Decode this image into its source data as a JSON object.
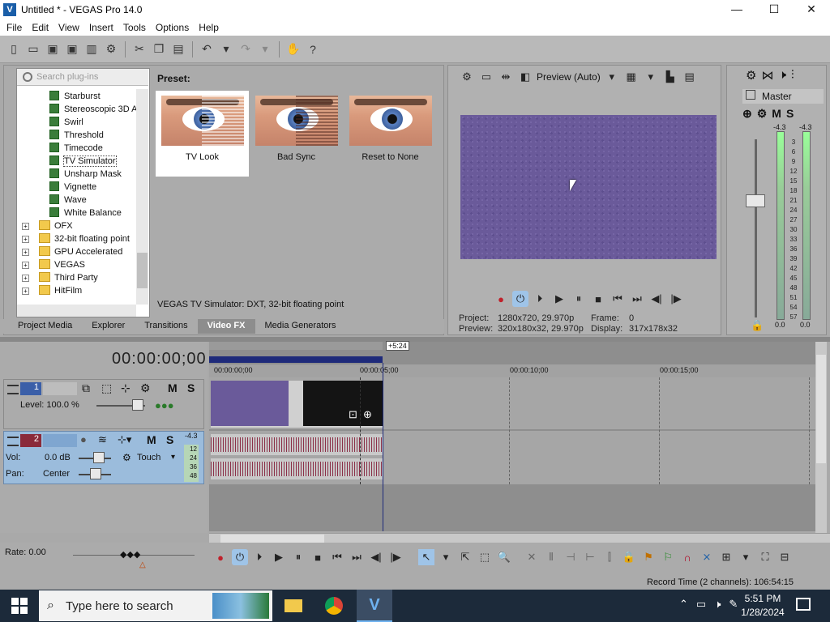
{
  "window": {
    "title": "Untitled * - VEGAS Pro 14.0",
    "logo": "V",
    "minimize": "—",
    "maximize": "☐",
    "close": "✕"
  },
  "menu": [
    "File",
    "Edit",
    "View",
    "Insert",
    "Tools",
    "Options",
    "Help"
  ],
  "plugins": {
    "search_placeholder": "Search plug-ins",
    "items": [
      "Starburst",
      "Stereoscopic 3D A",
      "Swirl",
      "Threshold",
      "Timecode",
      "TV Simulator",
      "Unsharp Mask",
      "Vignette",
      "Wave",
      "White Balance"
    ],
    "folders": [
      "OFX",
      "32-bit floating point",
      "GPU Accelerated",
      "VEGAS",
      "Third Party",
      "HitFilm"
    ],
    "selected": "TV Simulator"
  },
  "preset": {
    "label": "Preset:",
    "items": [
      "TV Look",
      "Bad Sync",
      "Reset to None"
    ],
    "status": "VEGAS TV Simulator: DXT, 32-bit floating point"
  },
  "tabs": [
    "Project Media",
    "Explorer",
    "Transitions",
    "Video FX",
    "Media Generators"
  ],
  "active_tab": "Video FX",
  "preview": {
    "mode": "Preview (Auto)",
    "project_label": "Project:",
    "project_value": "1280x720, 29.970p",
    "preview_label": "Preview:",
    "preview_value": "320x180x32, 29.970p",
    "frame_label": "Frame:",
    "frame_value": "0",
    "display_label": "Display:",
    "display_value": "317x178x32"
  },
  "mixer": {
    "label": "Master",
    "m": "M",
    "s": "S",
    "peak_left": "-4.3",
    "peak_right": "-4.3",
    "scale": [
      "3",
      "6",
      "9",
      "12",
      "15",
      "18",
      "21",
      "24",
      "27",
      "30",
      "33",
      "36",
      "39",
      "42",
      "45",
      "48",
      "51",
      "54",
      "57"
    ],
    "level_left": "0.0",
    "level_right": "0.0"
  },
  "timeline": {
    "timecode": "00:00:00;00",
    "loop_label": "+5:24",
    "ruler": [
      "00:00:00;00",
      "00:00:05;00",
      "00:00:10;00",
      "00:00:15;00"
    ],
    "track1": {
      "num": "1",
      "level": "Level: 100.0 %",
      "m": "M",
      "s": "S"
    },
    "track2": {
      "num": "2",
      "vol_label": "Vol:",
      "vol": "0.0 dB",
      "pan_label": "Pan:",
      "pan": "Center",
      "touch": "Touch",
      "m": "M",
      "s": "S",
      "peak": "-4.3",
      "scale": [
        "12",
        "24",
        "36",
        "48"
      ]
    },
    "rate": "Rate: 0.00",
    "record_time": "Record Time (2 channels): 106:54:15"
  },
  "taskbar": {
    "search": "Type here to search",
    "time": "5:51 PM",
    "date": "1/28/2024"
  }
}
